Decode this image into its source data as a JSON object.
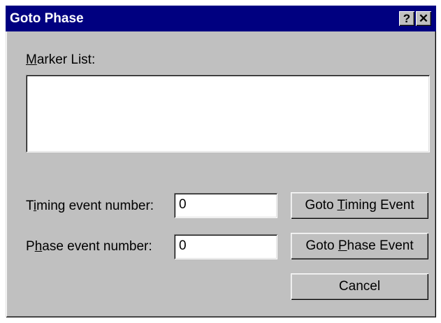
{
  "window": {
    "title": "Goto Phase",
    "help_label": "?",
    "close_label": "✕"
  },
  "marker_list": {
    "label_mnemonic": "M",
    "label_rest": "arker List:",
    "items": []
  },
  "timing": {
    "label_pre": "T",
    "label_mnemonic": "i",
    "label_rest": "ming event number:",
    "value": "0",
    "button_pre": "Goto ",
    "button_mnemonic": "T",
    "button_rest": "iming Event"
  },
  "phase": {
    "label_pre": "P",
    "label_mnemonic": "h",
    "label_rest": "ase event number:",
    "value": "0",
    "button_pre": "Goto ",
    "button_mnemonic": "P",
    "button_rest": "hase Event"
  },
  "cancel": {
    "label": "Cancel"
  },
  "colors": {
    "titlebar": "#000080",
    "face": "#c0c0c0",
    "field": "#ffffff"
  }
}
